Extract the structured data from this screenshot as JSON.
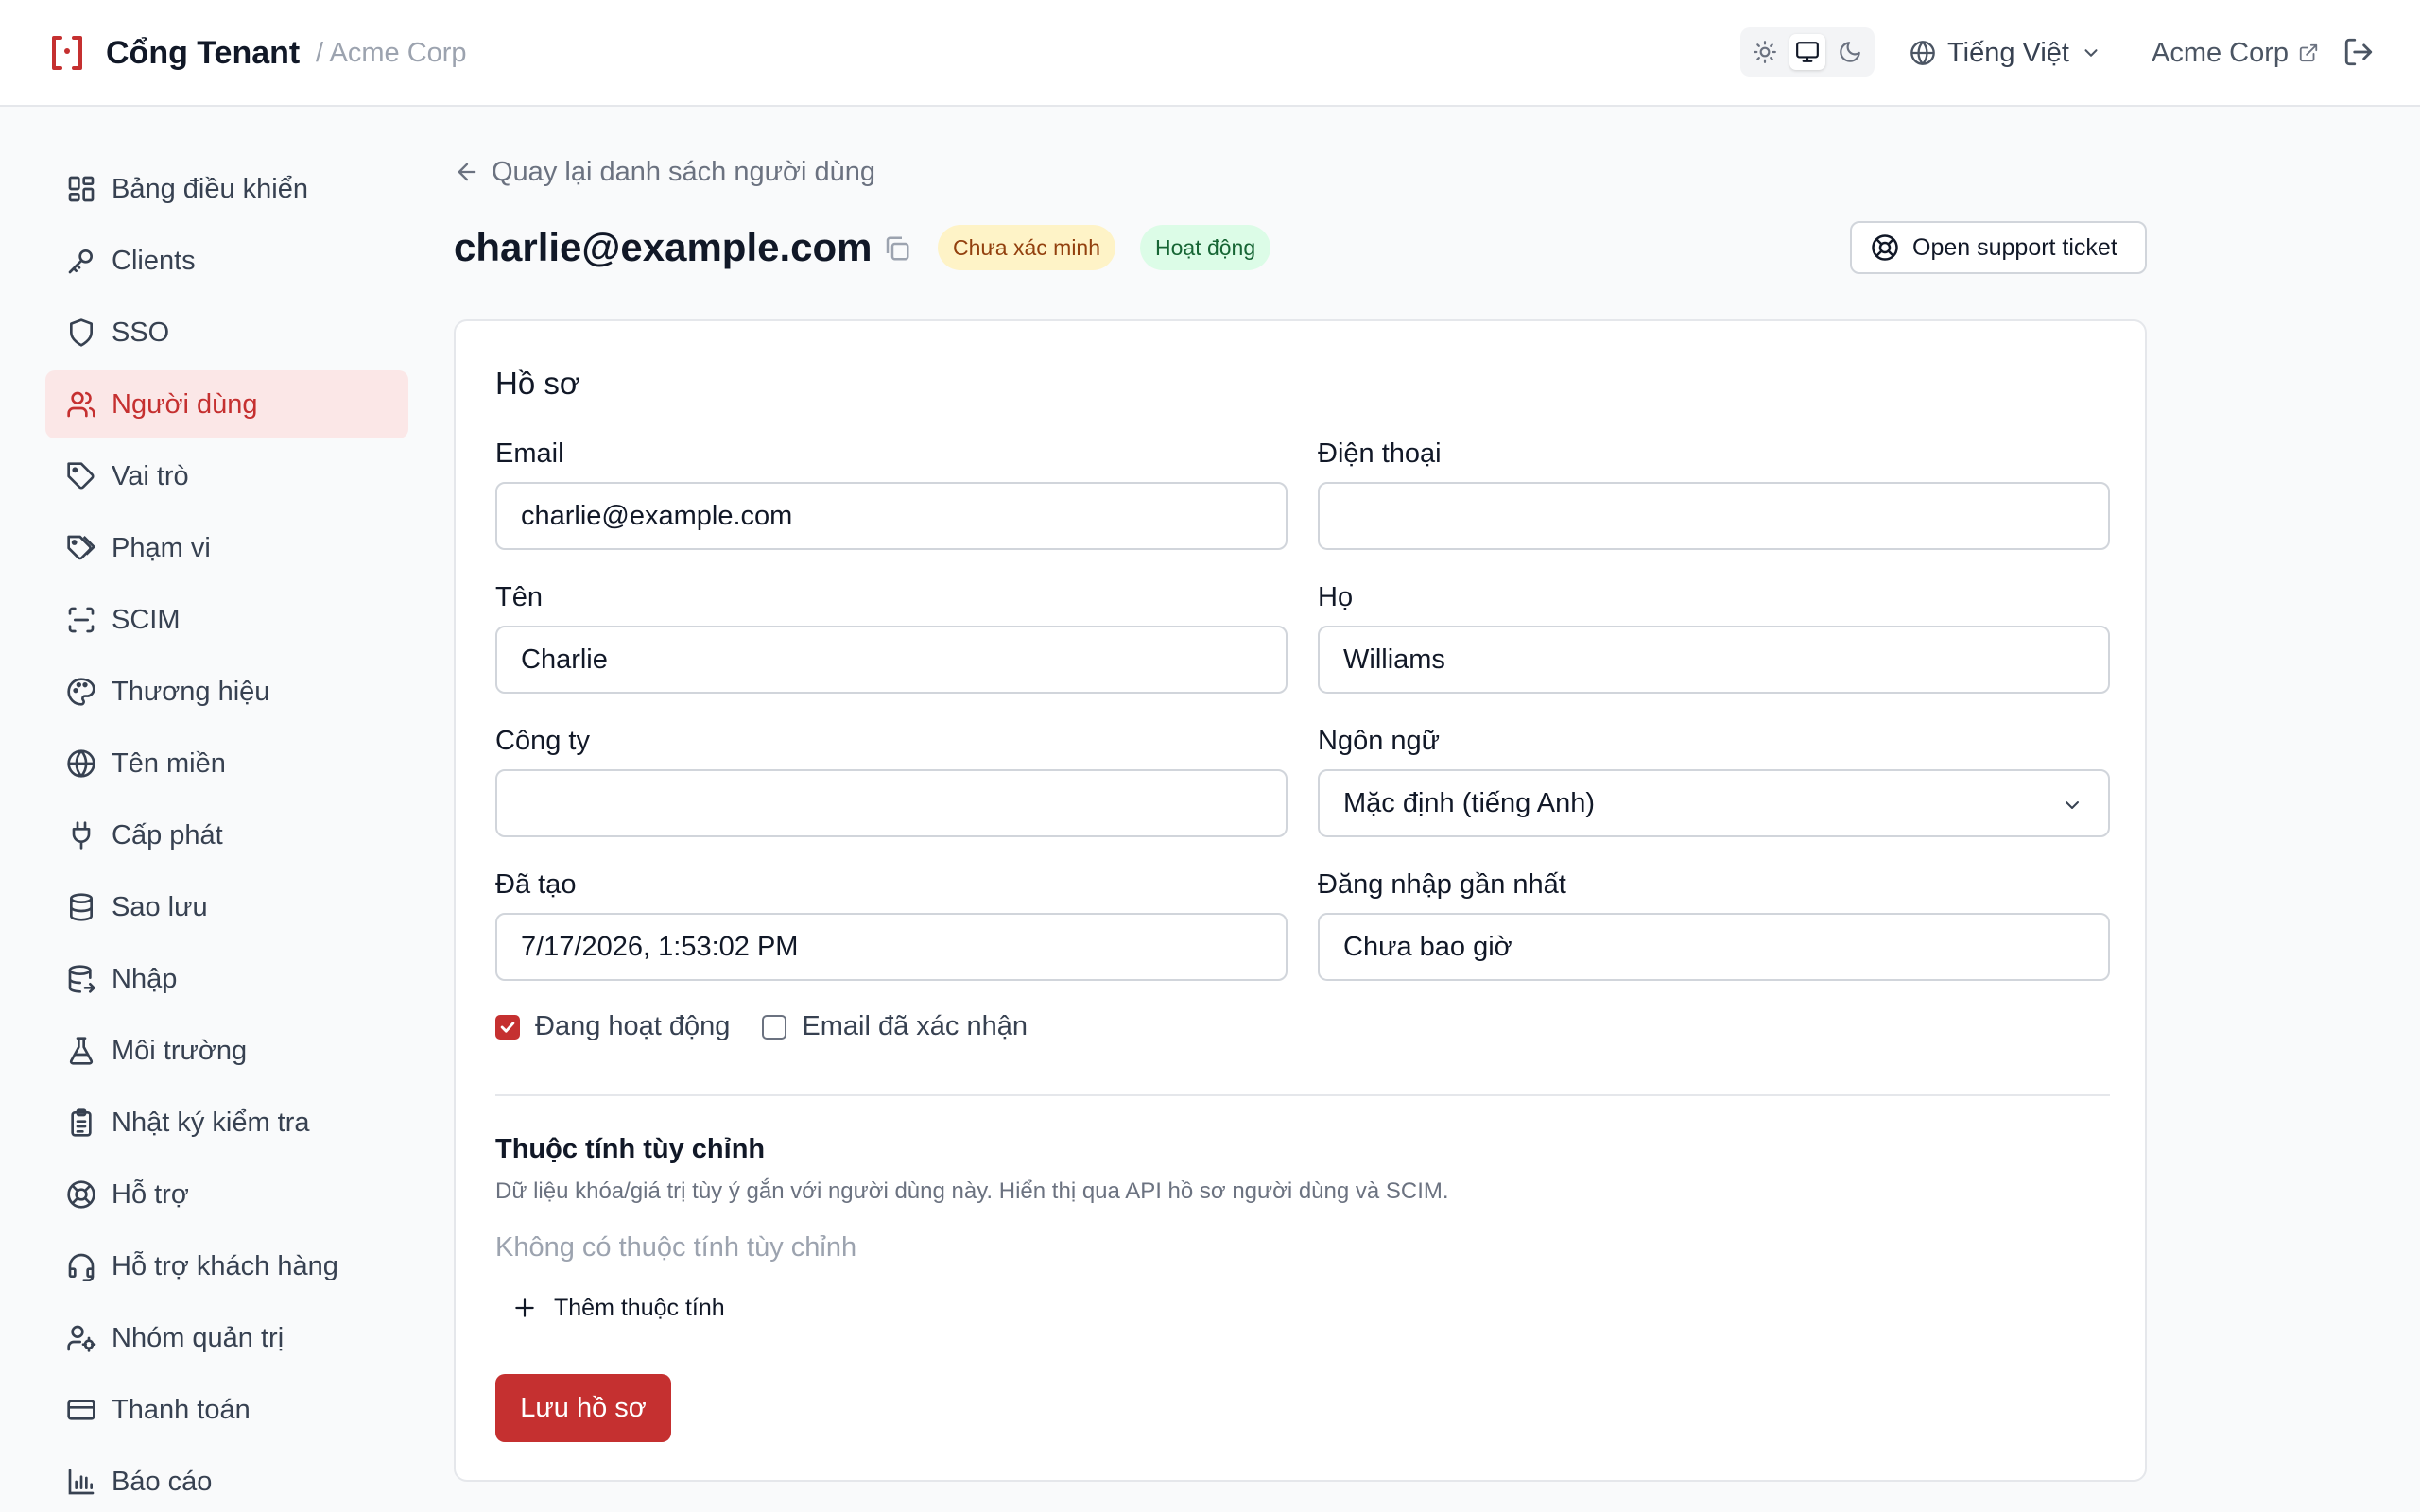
{
  "header": {
    "app_title": "Cổng Tenant",
    "org_breadcrumb": "/ Acme Corp",
    "language": "Tiếng Việt",
    "org_link": "Acme Corp",
    "theme_modes": [
      "light",
      "system",
      "dark"
    ],
    "active_theme": "system"
  },
  "sidebar": {
    "items": [
      {
        "label": "Bảng điều khiển",
        "icon": "dashboard-icon"
      },
      {
        "label": "Clients",
        "icon": "key-icon"
      },
      {
        "label": "SSO",
        "icon": "shield-icon"
      },
      {
        "label": "Người dùng",
        "icon": "users-icon",
        "active": true
      },
      {
        "label": "Vai trò",
        "icon": "tag-icon"
      },
      {
        "label": "Phạm vi",
        "icon": "tags-icon"
      },
      {
        "label": "SCIM",
        "icon": "scan-icon"
      },
      {
        "label": "Thương hiệu",
        "icon": "palette-icon"
      },
      {
        "label": "Tên miền",
        "icon": "globe-icon"
      },
      {
        "label": "Cấp phát",
        "icon": "plug-icon"
      },
      {
        "label": "Sao lưu",
        "icon": "database-icon"
      },
      {
        "label": "Nhập",
        "icon": "database-import-icon"
      },
      {
        "label": "Môi trường",
        "icon": "flask-icon"
      },
      {
        "label": "Nhật ký kiểm tra",
        "icon": "clipboard-icon"
      },
      {
        "label": "Hỗ trợ",
        "icon": "lifebuoy-icon"
      },
      {
        "label": "Hỗ trợ khách hàng",
        "icon": "headset-icon"
      },
      {
        "label": "Nhóm quản trị",
        "icon": "user-cog-icon"
      },
      {
        "label": "Thanh toán",
        "icon": "credit-card-icon"
      },
      {
        "label": "Báo cáo",
        "icon": "bar-chart-icon"
      }
    ]
  },
  "main": {
    "back_link": "Quay lại danh sách người dùng",
    "user_email": "charlie@example.com",
    "badges": {
      "unverified": "Chưa xác minh",
      "active": "Hoạt động"
    },
    "support_button": "Open support ticket",
    "profile": {
      "title": "Hồ sơ",
      "email": {
        "label": "Email",
        "value": "charlie@example.com"
      },
      "phone": {
        "label": "Điện thoại",
        "value": ""
      },
      "first_name": {
        "label": "Tên",
        "value": "Charlie"
      },
      "last_name": {
        "label": "Họ",
        "value": "Williams"
      },
      "company": {
        "label": "Công ty",
        "value": ""
      },
      "language": {
        "label": "Ngôn ngữ",
        "value": "Mặc định (tiếng Anh)"
      },
      "created": {
        "label": "Đã tạo",
        "value": "7/17/2026, 1:53:02 PM"
      },
      "last_login": {
        "label": "Đăng nhập gần nhất",
        "value": "Chưa bao giờ"
      },
      "active_check": {
        "label": "Đang hoạt động",
        "checked": true
      },
      "email_verified_check": {
        "label": "Email đã xác nhận",
        "checked": false
      }
    },
    "custom_attributes": {
      "title": "Thuộc tính tùy chỉnh",
      "description": "Dữ liệu khóa/giá trị tùy ý gắn với người dùng này. Hiển thị qua API hồ sơ người dùng và SCIM.",
      "empty": "Không có thuộc tính tùy chỉnh",
      "add_button": "Thêm thuộc tính"
    },
    "save_button": "Lưu hồ sơ"
  },
  "colors": {
    "accent": "#c53030",
    "active_nav_bg": "#fbe7e7",
    "warn_badge_bg": "#fef3c7",
    "ok_badge_bg": "#dcfce7"
  }
}
